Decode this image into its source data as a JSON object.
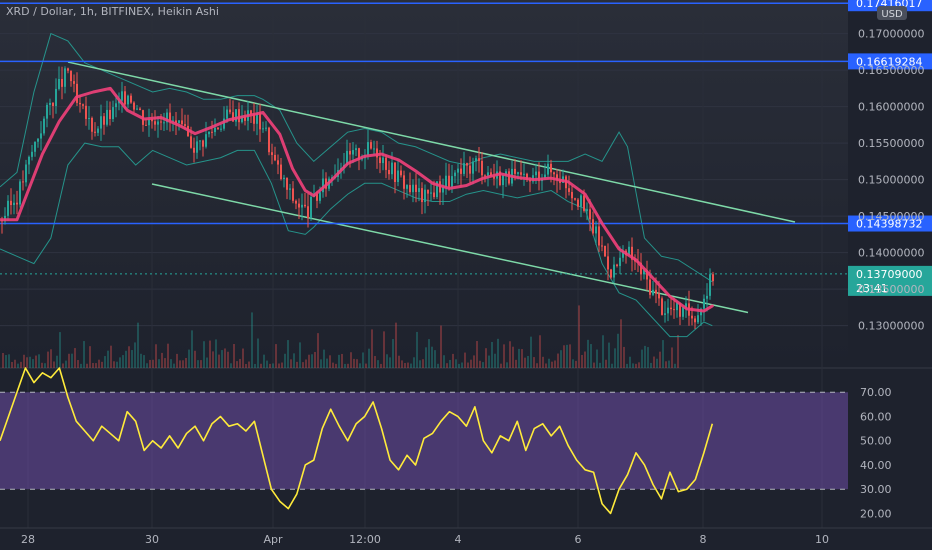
{
  "header": {
    "symbol": "XRD / Dollar, 1h, BITFINEX, Heikin Ashi",
    "currency_badge": "USD"
  },
  "colors": {
    "background": "#1e222d",
    "up": "#26a69a",
    "down": "#ef5350",
    "ema": "#f2407a",
    "bands": "#26a69a",
    "channel": "#7ed9a8",
    "hline": "#2962ff",
    "rsi": "#ffeb3b",
    "rsi_band": "#7e57c2"
  },
  "chart_data": [
    {
      "type": "candlestick",
      "title": "XRD / Dollar, 1h, BITFINEX, Heikin Ashi",
      "y_axis_ticks": [
        "0.13000000",
        "0.13500000",
        "0.14000000",
        "0.14500000",
        "0.15000000",
        "0.15500000",
        "0.16000000",
        "0.16500000",
        "0.17000000"
      ],
      "ylim": [
        0.1242,
        0.1746
      ],
      "x_axis_labels": [
        "28",
        "30",
        "Apr",
        "12:00",
        "4",
        "6",
        "8",
        "10"
      ],
      "horizontal_levels": [
        {
          "value": 0.17416017,
          "label": "0.17416017"
        },
        {
          "value": 0.16619284,
          "label": "0.16619284"
        },
        {
          "value": 0.14398732,
          "label": "0.14398732"
        }
      ],
      "current_price": {
        "value": 0.13709,
        "label": "0.13709000",
        "countdown": "23:41"
      },
      "channel": {
        "upper": {
          "from": [
            0.0,
            0.1661
          ],
          "to": [
            1.0,
            0.1442
          ]
        },
        "lower": {
          "from": [
            0.0,
            0.1494
          ],
          "to": [
            1.0,
            0.1318
          ]
        }
      },
      "ema_path": [
        [
          0,
          0.1445
        ],
        [
          0.02,
          0.1445
        ],
        [
          0.05,
          0.1535
        ],
        [
          0.07,
          0.158
        ],
        [
          0.09,
          0.1613
        ],
        [
          0.11,
          0.162
        ],
        [
          0.13,
          0.1625
        ],
        [
          0.15,
          0.1595
        ],
        [
          0.17,
          0.1583
        ],
        [
          0.19,
          0.1585
        ],
        [
          0.21,
          0.1575
        ],
        [
          0.23,
          0.1563
        ],
        [
          0.25,
          0.1572
        ],
        [
          0.27,
          0.1582
        ],
        [
          0.29,
          0.1587
        ],
        [
          0.31,
          0.1592
        ],
        [
          0.33,
          0.1562
        ],
        [
          0.345,
          0.1515
        ],
        [
          0.36,
          0.1485
        ],
        [
          0.37,
          0.1478
        ],
        [
          0.39,
          0.1498
        ],
        [
          0.41,
          0.1522
        ],
        [
          0.43,
          0.1532
        ],
        [
          0.45,
          0.1535
        ],
        [
          0.47,
          0.1527
        ],
        [
          0.49,
          0.1512
        ],
        [
          0.51,
          0.1495
        ],
        [
          0.53,
          0.1488
        ],
        [
          0.55,
          0.1492
        ],
        [
          0.57,
          0.1502
        ],
        [
          0.59,
          0.1508
        ],
        [
          0.61,
          0.1503
        ],
        [
          0.63,
          0.15
        ],
        [
          0.65,
          0.1502
        ],
        [
          0.67,
          0.1497
        ],
        [
          0.69,
          0.148
        ],
        [
          0.71,
          0.144
        ],
        [
          0.73,
          0.1405
        ],
        [
          0.75,
          0.139
        ],
        [
          0.77,
          0.1365
        ],
        [
          0.79,
          0.134
        ],
        [
          0.81,
          0.1323
        ],
        [
          0.83,
          0.132
        ],
        [
          0.84,
          0.1327
        ]
      ],
      "band_upper": [
        [
          0,
          0.149
        ],
        [
          0.02,
          0.151
        ],
        [
          0.04,
          0.162
        ],
        [
          0.06,
          0.17
        ],
        [
          0.08,
          0.169
        ],
        [
          0.1,
          0.166
        ],
        [
          0.12,
          0.165
        ],
        [
          0.14,
          0.164
        ],
        [
          0.16,
          0.163
        ],
        [
          0.18,
          0.162
        ],
        [
          0.2,
          0.1625
        ],
        [
          0.22,
          0.162
        ],
        [
          0.24,
          0.161
        ],
        [
          0.26,
          0.161
        ],
        [
          0.28,
          0.1615
        ],
        [
          0.3,
          0.1615
        ],
        [
          0.31,
          0.161
        ],
        [
          0.33,
          0.1595
        ],
        [
          0.35,
          0.155
        ],
        [
          0.37,
          0.1525
        ],
        [
          0.39,
          0.1545
        ],
        [
          0.41,
          0.1565
        ],
        [
          0.43,
          0.157
        ],
        [
          0.45,
          0.1565
        ],
        [
          0.47,
          0.155
        ],
        [
          0.49,
          0.1545
        ],
        [
          0.51,
          0.1535
        ],
        [
          0.53,
          0.1525
        ],
        [
          0.55,
          0.152
        ],
        [
          0.57,
          0.153
        ],
        [
          0.59,
          0.1535
        ],
        [
          0.61,
          0.153
        ],
        [
          0.63,
          0.1525
        ],
        [
          0.65,
          0.1525
        ],
        [
          0.67,
          0.1525
        ],
        [
          0.69,
          0.1535
        ],
        [
          0.71,
          0.1525
        ],
        [
          0.73,
          0.1565
        ],
        [
          0.74,
          0.1545
        ],
        [
          0.76,
          0.142
        ],
        [
          0.78,
          0.1395
        ],
        [
          0.8,
          0.139
        ],
        [
          0.82,
          0.1375
        ],
        [
          0.84,
          0.136
        ]
      ],
      "band_lower": [
        [
          0,
          0.1405
        ],
        [
          0.02,
          0.1395
        ],
        [
          0.04,
          0.1385
        ],
        [
          0.06,
          0.142
        ],
        [
          0.08,
          0.152
        ],
        [
          0.1,
          0.155
        ],
        [
          0.12,
          0.1545
        ],
        [
          0.14,
          0.1545
        ],
        [
          0.16,
          0.152
        ],
        [
          0.18,
          0.154
        ],
        [
          0.2,
          0.153
        ],
        [
          0.22,
          0.152
        ],
        [
          0.24,
          0.1525
        ],
        [
          0.26,
          0.153
        ],
        [
          0.28,
          0.154
        ],
        [
          0.3,
          0.154
        ],
        [
          0.32,
          0.1495
        ],
        [
          0.34,
          0.143
        ],
        [
          0.36,
          0.1425
        ],
        [
          0.37,
          0.1435
        ],
        [
          0.39,
          0.146
        ],
        [
          0.41,
          0.148
        ],
        [
          0.43,
          0.1495
        ],
        [
          0.45,
          0.1495
        ],
        [
          0.47,
          0.1485
        ],
        [
          0.49,
          0.1475
        ],
        [
          0.51,
          0.147
        ],
        [
          0.53,
          0.147
        ],
        [
          0.55,
          0.148
        ],
        [
          0.57,
          0.1485
        ],
        [
          0.59,
          0.148
        ],
        [
          0.61,
          0.1475
        ],
        [
          0.63,
          0.148
        ],
        [
          0.65,
          0.1485
        ],
        [
          0.67,
          0.147
        ],
        [
          0.69,
          0.146
        ],
        [
          0.71,
          0.1385
        ],
        [
          0.73,
          0.1345
        ],
        [
          0.75,
          0.1335
        ],
        [
          0.77,
          0.131
        ],
        [
          0.79,
          0.1285
        ],
        [
          0.81,
          0.1285
        ],
        [
          0.83,
          0.1305
        ],
        [
          0.84,
          0.13
        ]
      ],
      "candles_close": [
        [
          0,
          0.1445
        ],
        [
          0.02,
          0.148
        ],
        [
          0.04,
          0.155
        ],
        [
          0.06,
          0.161
        ],
        [
          0.08,
          0.165
        ],
        [
          0.09,
          0.16
        ],
        [
          0.11,
          0.157
        ],
        [
          0.13,
          0.159
        ],
        [
          0.15,
          0.162
        ],
        [
          0.17,
          0.158
        ],
        [
          0.19,
          0.159
        ],
        [
          0.21,
          0.157
        ],
        [
          0.23,
          0.1545
        ],
        [
          0.25,
          0.157
        ],
        [
          0.27,
          0.159
        ],
        [
          0.29,
          0.159
        ],
        [
          0.31,
          0.1575
        ],
        [
          0.32,
          0.153
        ],
        [
          0.34,
          0.148
        ],
        [
          0.36,
          0.1455
        ],
        [
          0.38,
          0.149
        ],
        [
          0.4,
          0.1525
        ],
        [
          0.42,
          0.1535
        ],
        [
          0.44,
          0.1545
        ],
        [
          0.46,
          0.1515
        ],
        [
          0.48,
          0.149
        ],
        [
          0.5,
          0.1475
        ],
        [
          0.52,
          0.1495
        ],
        [
          0.54,
          0.1505
        ],
        [
          0.56,
          0.1525
        ],
        [
          0.58,
          0.1505
        ],
        [
          0.6,
          0.1505
        ],
        [
          0.62,
          0.1495
        ],
        [
          0.64,
          0.1515
        ],
        [
          0.66,
          0.1505
        ],
        [
          0.68,
          0.1475
        ],
        [
          0.7,
          0.143
        ],
        [
          0.72,
          0.1375
        ],
        [
          0.74,
          0.14
        ],
        [
          0.76,
          0.1365
        ],
        [
          0.78,
          0.1325
        ],
        [
          0.8,
          0.132
        ],
        [
          0.82,
          0.1315
        ],
        [
          0.84,
          0.1371
        ]
      ]
    },
    {
      "type": "line",
      "title": "RSI",
      "y_axis_ticks": [
        "20.00",
        "30.00",
        "40.00",
        "50.00",
        "60.00",
        "70.00"
      ],
      "ylim": [
        14,
        80
      ],
      "bands": [
        30,
        70
      ],
      "series": [
        {
          "values": [
            [
              0,
              50
            ],
            [
              0.01,
              60
            ],
            [
              0.02,
              70
            ],
            [
              0.03,
              80
            ],
            [
              0.04,
              74
            ],
            [
              0.05,
              78
            ],
            [
              0.06,
              76
            ],
            [
              0.07,
              80
            ],
            [
              0.08,
              68
            ],
            [
              0.09,
              58
            ],
            [
              0.1,
              54
            ],
            [
              0.11,
              50
            ],
            [
              0.12,
              56
            ],
            [
              0.13,
              53
            ],
            [
              0.14,
              50
            ],
            [
              0.15,
              62
            ],
            [
              0.16,
              58
            ],
            [
              0.17,
              46
            ],
            [
              0.18,
              50
            ],
            [
              0.19,
              47
            ],
            [
              0.2,
              52
            ],
            [
              0.21,
              47
            ],
            [
              0.22,
              53
            ],
            [
              0.23,
              56
            ],
            [
              0.24,
              50
            ],
            [
              0.25,
              57
            ],
            [
              0.26,
              60
            ],
            [
              0.27,
              56
            ],
            [
              0.28,
              57
            ],
            [
              0.29,
              54
            ],
            [
              0.3,
              58
            ],
            [
              0.31,
              44
            ],
            [
              0.32,
              30
            ],
            [
              0.33,
              25
            ],
            [
              0.34,
              22
            ],
            [
              0.35,
              28
            ],
            [
              0.36,
              40
            ],
            [
              0.37,
              42
            ],
            [
              0.38,
              55
            ],
            [
              0.39,
              63
            ],
            [
              0.4,
              56
            ],
            [
              0.41,
              50
            ],
            [
              0.42,
              57
            ],
            [
              0.43,
              60
            ],
            [
              0.44,
              66
            ],
            [
              0.45,
              55
            ],
            [
              0.46,
              42
            ],
            [
              0.47,
              38
            ],
            [
              0.48,
              44
            ],
            [
              0.49,
              40
            ],
            [
              0.5,
              51
            ],
            [
              0.51,
              53
            ],
            [
              0.52,
              58
            ],
            [
              0.53,
              62
            ],
            [
              0.54,
              60
            ],
            [
              0.55,
              56
            ],
            [
              0.56,
              64
            ],
            [
              0.57,
              50
            ],
            [
              0.58,
              45
            ],
            [
              0.59,
              52
            ],
            [
              0.6,
              50
            ],
            [
              0.61,
              58
            ],
            [
              0.62,
              46
            ],
            [
              0.63,
              55
            ],
            [
              0.64,
              57
            ],
            [
              0.65,
              52
            ],
            [
              0.66,
              56
            ],
            [
              0.67,
              48
            ],
            [
              0.68,
              42
            ],
            [
              0.69,
              38
            ],
            [
              0.7,
              37
            ],
            [
              0.71,
              24
            ],
            [
              0.72,
              20
            ],
            [
              0.73,
              30
            ],
            [
              0.74,
              36
            ],
            [
              0.75,
              45
            ],
            [
              0.76,
              40
            ],
            [
              0.77,
              32
            ],
            [
              0.78,
              26
            ],
            [
              0.79,
              37
            ],
            [
              0.8,
              29
            ],
            [
              0.81,
              30
            ],
            [
              0.82,
              34
            ],
            [
              0.83,
              45
            ],
            [
              0.84,
              57
            ]
          ]
        }
      ]
    }
  ],
  "x_labels": [
    "28",
    "30",
    "Apr",
    "12:00",
    "4",
    "6",
    "8",
    "10"
  ]
}
